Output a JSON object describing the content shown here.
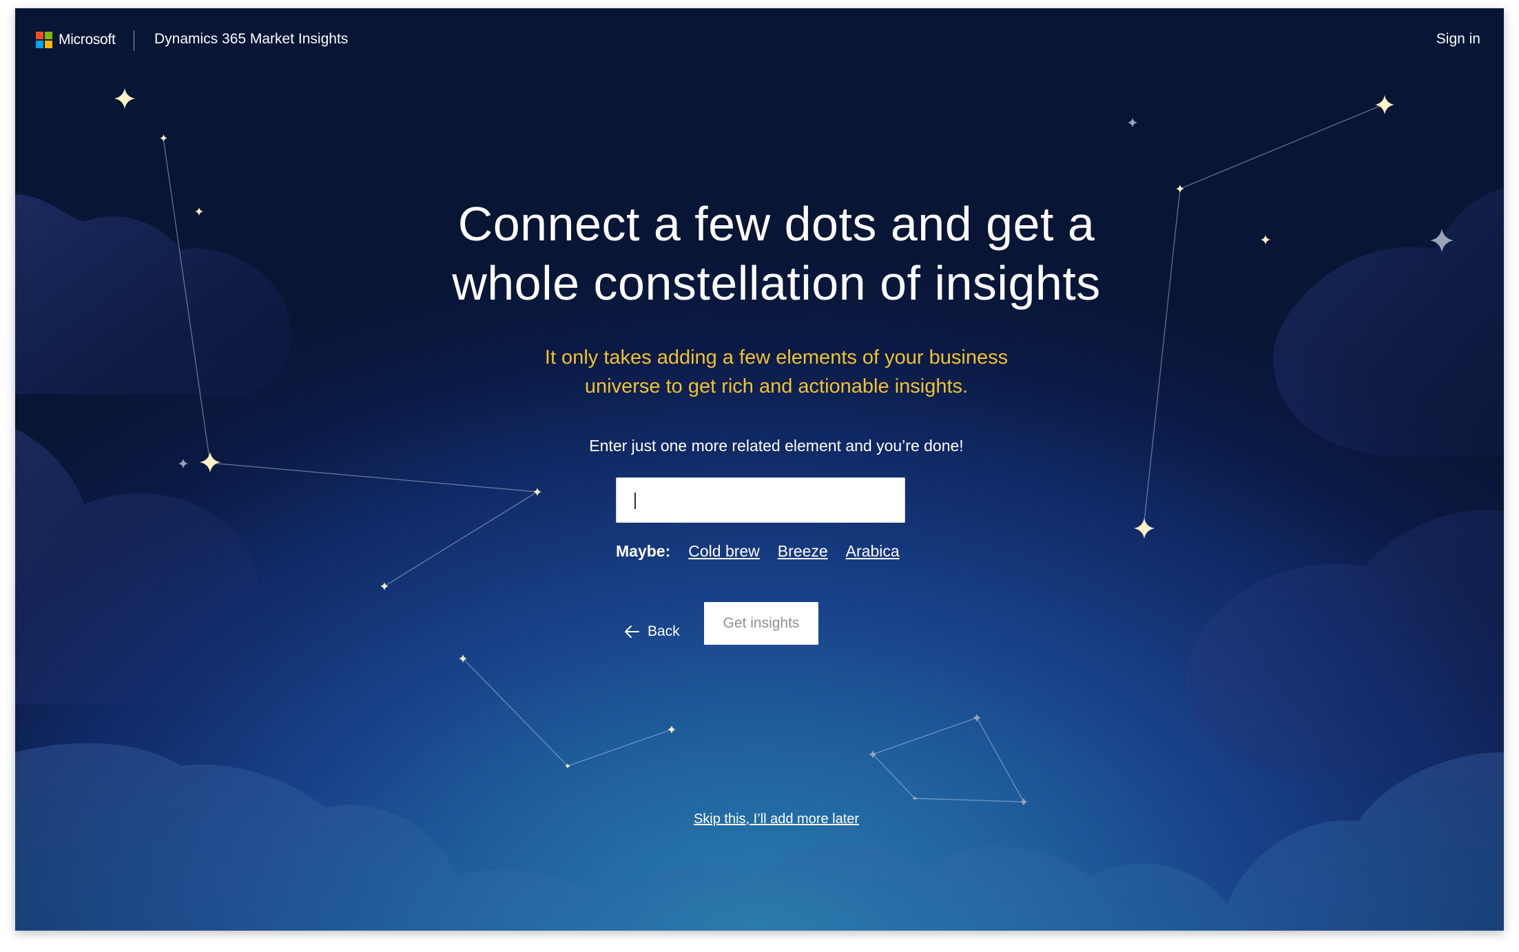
{
  "header": {
    "brand": "Microsoft",
    "app_name": "Dynamics 365 Market Insights",
    "sign_in": "Sign in",
    "logo_colors": [
      "#f25022",
      "#7fba00",
      "#00a4ef",
      "#ffb900"
    ]
  },
  "main": {
    "headline_line1": "Connect a few dots and get a",
    "headline_line2": "whole constellation of insights",
    "subhead_line1": "It only takes adding a few elements of your business",
    "subhead_line2": "universe to get rich and actionable insights.",
    "prompt": "Enter just one more related element and you’re done!",
    "input_value": "",
    "maybe_label": "Maybe:",
    "suggestions": [
      "Cold brew",
      "Breeze",
      "Arabica"
    ],
    "back_label": "Back",
    "get_insights_label": "Get insights",
    "skip_label": "Skip this, I’ll add more later"
  },
  "colors": {
    "accent_yellow": "#f2c230",
    "sky_dark": "#081535",
    "sky_light": "#2a7fb1",
    "star": "#fdf3c4"
  },
  "icons": {
    "back": "arrow-left-icon",
    "stars": "sparkle-star-icon"
  }
}
